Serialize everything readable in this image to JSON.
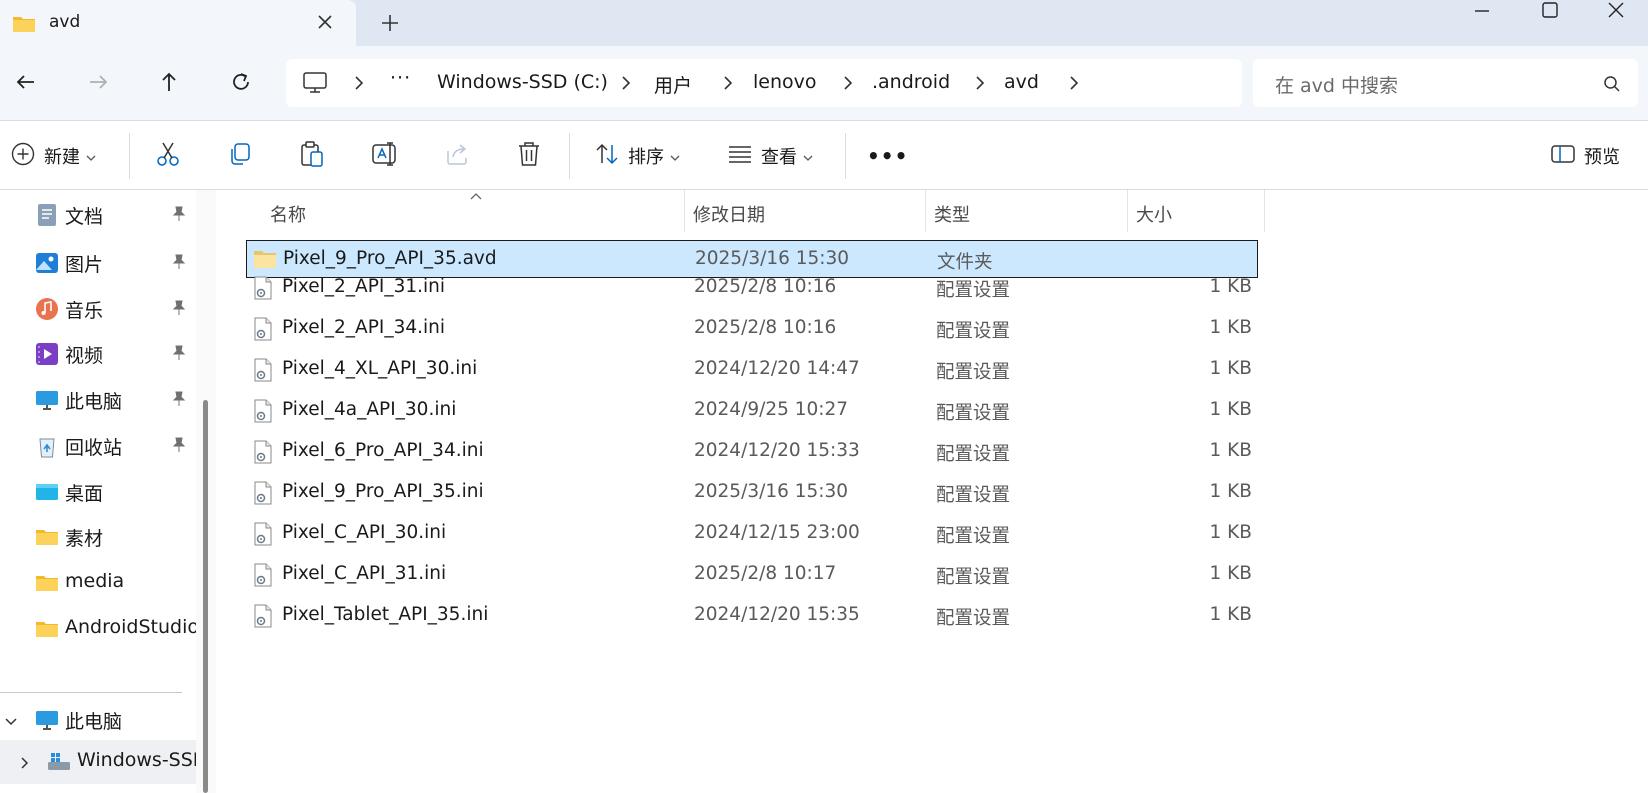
{
  "tab": {
    "title": "avd"
  },
  "address": {
    "overflow": "···",
    "crumbs": [
      "Windows-SSD (C:)",
      "用户",
      "lenovo",
      ".android",
      "avd"
    ]
  },
  "search": {
    "placeholder": "在 avd 中搜索"
  },
  "toolbar": {
    "new_label": "新建",
    "sort_label": "排序",
    "view_label": "查看",
    "more_label": "•••",
    "preview_label": "预览"
  },
  "sidebar": {
    "items": [
      {
        "label": "文档",
        "icon": "documents-icon",
        "pinned": true
      },
      {
        "label": "图片",
        "icon": "pictures-icon",
        "pinned": true
      },
      {
        "label": "音乐",
        "icon": "music-icon",
        "pinned": true
      },
      {
        "label": "视频",
        "icon": "videos-icon",
        "pinned": true
      },
      {
        "label": "此电脑",
        "icon": "this-pc-icon",
        "pinned": true
      },
      {
        "label": "回收站",
        "icon": "recycle-bin-icon",
        "pinned": true
      },
      {
        "label": "桌面",
        "icon": "desktop-icon",
        "pinned": false
      },
      {
        "label": "素材",
        "icon": "folder-icon",
        "pinned": false
      },
      {
        "label": "media",
        "icon": "folder-icon",
        "pinned": false
      },
      {
        "label": "AndroidStudio",
        "icon": "folder-icon",
        "pinned": false
      }
    ],
    "this_pc": "此电脑",
    "drive": "Windows-SSD"
  },
  "columns": {
    "name": "名称",
    "modified": "修改日期",
    "type": "类型",
    "size": "大小"
  },
  "files": [
    {
      "name": "Pixel_9_Pro_API_35.avd",
      "modified": "2025/3/16 15:30",
      "type": "文件夹",
      "size": "",
      "kind": "folder",
      "selected": true
    },
    {
      "name": "Pixel_2_API_31.ini",
      "modified": "2025/2/8 10:16",
      "type": "配置设置",
      "size": "1 KB",
      "kind": "ini"
    },
    {
      "name": "Pixel_2_API_34.ini",
      "modified": "2025/2/8 10:16",
      "type": "配置设置",
      "size": "1 KB",
      "kind": "ini"
    },
    {
      "name": "Pixel_4_XL_API_30.ini",
      "modified": "2024/12/20 14:47",
      "type": "配置设置",
      "size": "1 KB",
      "kind": "ini"
    },
    {
      "name": "Pixel_4a_API_30.ini",
      "modified": "2024/9/25 10:27",
      "type": "配置设置",
      "size": "1 KB",
      "kind": "ini"
    },
    {
      "name": "Pixel_6_Pro_API_34.ini",
      "modified": "2024/12/20 15:33",
      "type": "配置设置",
      "size": "1 KB",
      "kind": "ini"
    },
    {
      "name": "Pixel_9_Pro_API_35.ini",
      "modified": "2025/3/16 15:30",
      "type": "配置设置",
      "size": "1 KB",
      "kind": "ini"
    },
    {
      "name": "Pixel_C_API_30.ini",
      "modified": "2024/12/15 23:00",
      "type": "配置设置",
      "size": "1 KB",
      "kind": "ini"
    },
    {
      "name": "Pixel_C_API_31.ini",
      "modified": "2025/2/8 10:17",
      "type": "配置设置",
      "size": "1 KB",
      "kind": "ini"
    },
    {
      "name": "Pixel_Tablet_API_35.ini",
      "modified": "2024/12/20 15:35",
      "type": "配置设置",
      "size": "1 KB",
      "kind": "ini"
    }
  ],
  "colors": {
    "accent": "#0067c0",
    "selection": "#cce8ff",
    "folder": "#f8c84a",
    "titlebar": "#dfe7f2"
  }
}
